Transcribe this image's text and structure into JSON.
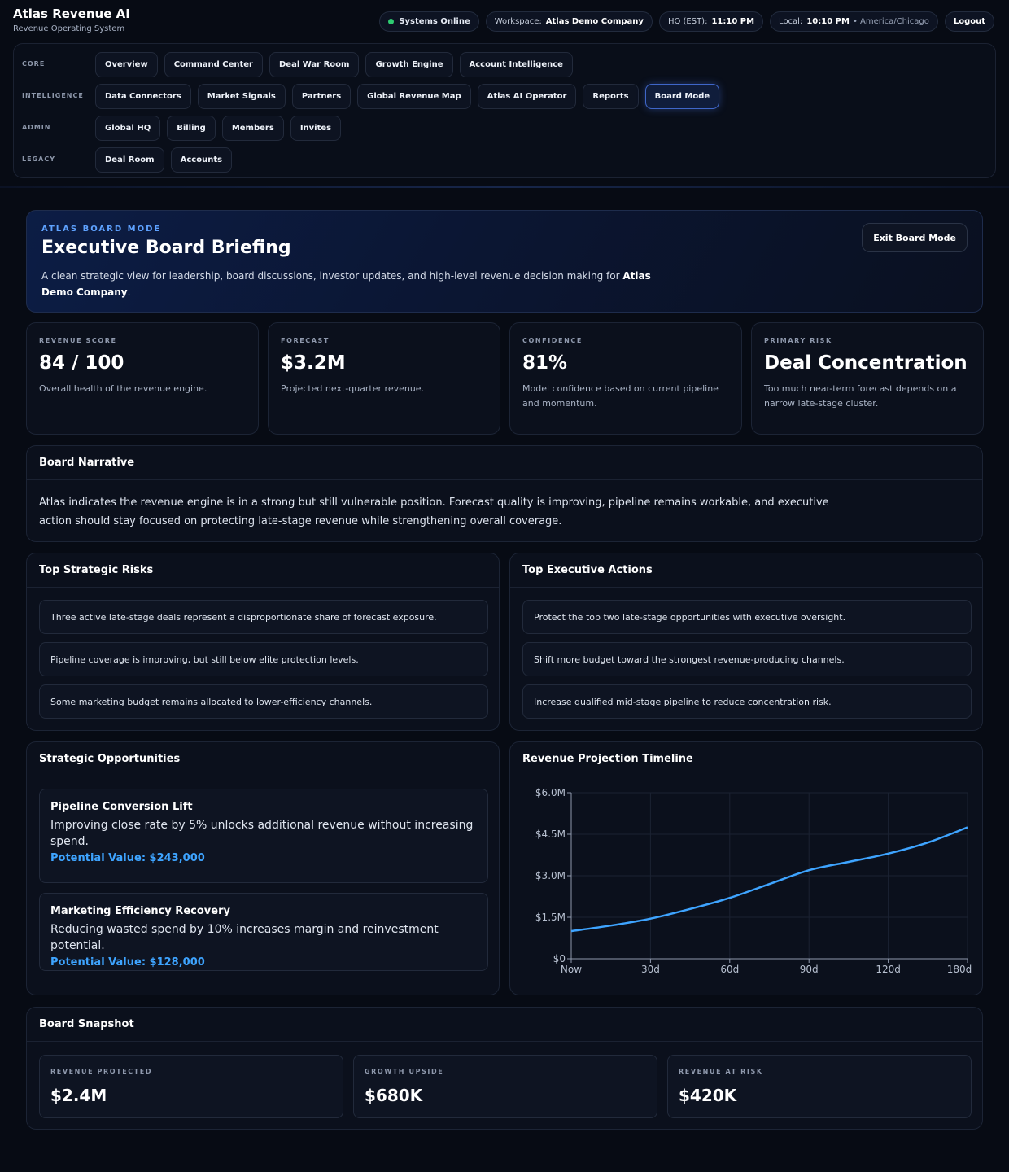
{
  "app": {
    "title": "Atlas Revenue AI",
    "subtitle": "Revenue Operating System"
  },
  "status": {
    "systems": "Systems Online",
    "workspace_label": "Workspace:",
    "workspace_value": "Atlas Demo Company",
    "hq_label": "HQ (EST):",
    "hq_time": "11:10 PM",
    "local_label": "Local:",
    "local_time": "10:10 PM",
    "local_tz": "• America/Chicago",
    "logout": "Logout",
    "online_color": "#2ecc71"
  },
  "nav": {
    "groups": [
      {
        "label": "CORE",
        "items": [
          "Overview",
          "Command Center",
          "Deal War Room",
          "Growth Engine",
          "Account Intelligence"
        ]
      },
      {
        "label": "INTELLIGENCE",
        "items": [
          "Data Connectors",
          "Market Signals",
          "Partners",
          "Global Revenue Map",
          "Atlas AI Operator",
          "Reports",
          "Board Mode"
        ]
      },
      {
        "label": "ADMIN",
        "items": [
          "Global HQ",
          "Billing",
          "Members",
          "Invites"
        ]
      },
      {
        "label": "LEGACY",
        "items": [
          "Deal Room",
          "Accounts"
        ]
      }
    ],
    "active": "Board Mode"
  },
  "hero": {
    "eyebrow": "ATLAS BOARD MODE",
    "title": "Executive Board Briefing",
    "desc_prefix": "A clean strategic view for leadership, board discussions, investor updates, and high-level revenue decision making for ",
    "desc_company": "Atlas Demo Company",
    "desc_suffix": ".",
    "exit": "Exit Board Mode"
  },
  "kpis": [
    {
      "label": "REVENUE SCORE",
      "value": "84 / 100",
      "desc": "Overall health of the revenue engine."
    },
    {
      "label": "FORECAST",
      "value": "$3.2M",
      "desc": "Projected next-quarter revenue."
    },
    {
      "label": "CONFIDENCE",
      "value": "81%",
      "desc": "Model confidence based on current pipeline and momentum."
    },
    {
      "label": "PRIMARY RISK",
      "value": "Deal Concentration",
      "desc": "Too much near-term forecast depends on a narrow late-stage cluster."
    }
  ],
  "narrative": {
    "title": "Board Narrative",
    "text": "Atlas indicates the revenue engine is in a strong but still vulnerable position. Forecast quality is improving, pipeline remains workable, and executive action should stay focused on protecting late-stage revenue while strengthening overall coverage."
  },
  "risks": {
    "title": "Top Strategic Risks",
    "items": [
      "Three active late-stage deals represent a disproportionate share of forecast exposure.",
      "Pipeline coverage is improving, but still below elite protection levels.",
      "Some marketing budget remains allocated to lower-efficiency channels."
    ]
  },
  "actions": {
    "title": "Top Executive Actions",
    "items": [
      "Protect the top two late-stage opportunities with executive oversight.",
      "Shift more budget toward the strongest revenue-producing channels.",
      "Increase qualified mid-stage pipeline to reduce concentration risk."
    ]
  },
  "opportunities": {
    "title": "Strategic Opportunities",
    "items": [
      {
        "title": "Pipeline Conversion Lift",
        "desc": "Improving close rate by 5% unlocks additional revenue without increasing spend.",
        "value": "Potential Value: $243,000"
      },
      {
        "title": "Marketing Efficiency Recovery",
        "desc": "Reducing wasted spend by 10% increases margin and reinvestment potential.",
        "value": "Potential Value: $128,000"
      }
    ]
  },
  "timeline": {
    "title": "Revenue Projection Timeline"
  },
  "chart_data": {
    "type": "line",
    "title": "Revenue Projection Timeline",
    "x": [
      0,
      15,
      30,
      45,
      60,
      75,
      90,
      105,
      120,
      135,
      150,
      165,
      180
    ],
    "x_tick_labels": [
      "Now",
      "30d",
      "60d",
      "90d",
      "120d",
      "180d"
    ],
    "x_ticks": [
      0,
      30,
      60,
      90,
      120,
      150
    ],
    "y_tick_labels": [
      "$0",
      "$1.5M",
      "$3.0M",
      "$4.5M",
      "$6.0M"
    ],
    "y_ticks": [
      0,
      1.5,
      3.0,
      4.5,
      6.0
    ],
    "xlim": [
      0,
      150
    ],
    "ylim": [
      0,
      6.0
    ],
    "series": [
      {
        "values": [
          1.0,
          1.2,
          1.45,
          1.8,
          2.2,
          2.7,
          3.2,
          3.5,
          3.8,
          4.2,
          4.75
        ]
      }
    ],
    "series_x": [
      0,
      15,
      30,
      45,
      60,
      75,
      90,
      105,
      120,
      135,
      150
    ],
    "grid": true,
    "line_color": "#3ea4ff"
  },
  "snapshot": {
    "title": "Board Snapshot",
    "items": [
      {
        "label": "REVENUE PROTECTED",
        "value": "$2.4M"
      },
      {
        "label": "GROWTH UPSIDE",
        "value": "$680K"
      },
      {
        "label": "REVENUE AT RISK",
        "value": "$420K"
      }
    ]
  }
}
